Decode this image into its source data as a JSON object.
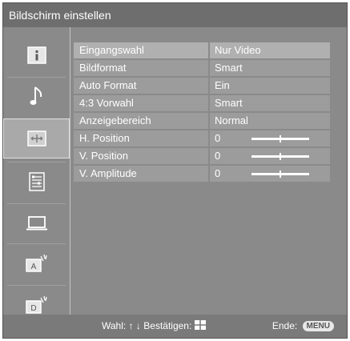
{
  "title": "Bildschirm einstellen",
  "sidebar": {
    "items": [
      {
        "icon": "info-icon"
      },
      {
        "icon": "music-note-icon"
      },
      {
        "icon": "screen-adjust-icon",
        "selected": true
      },
      {
        "icon": "list-settings-icon"
      },
      {
        "icon": "monitor-icon"
      },
      {
        "icon": "analog-broadcast-icon",
        "letter": "A"
      },
      {
        "icon": "digital-broadcast-icon",
        "letter": "D"
      }
    ]
  },
  "menu": {
    "rows": [
      {
        "label": "Eingangswahl",
        "value": "Nur Video"
      },
      {
        "label": "Bildformat",
        "value": "Smart"
      },
      {
        "label": "Auto Format",
        "value": "Ein"
      },
      {
        "label": "4:3 Vorwahl",
        "value": "Smart"
      },
      {
        "label": "Anzeigebereich",
        "value": "Normal"
      },
      {
        "label": "H. Position",
        "value": "0",
        "slider": 0.5
      },
      {
        "label": "V. Position",
        "value": "0",
        "slider": 0.5
      },
      {
        "label": "V. Amplitude",
        "value": "0",
        "slider": 0.5
      }
    ]
  },
  "footer": {
    "help_prefix": "Wahl:",
    "up_arrow": "↑",
    "down_arrow": "↓",
    "confirm_label": "Bestätigen:",
    "end_label": "Ende:",
    "menu_button": "MENU"
  }
}
